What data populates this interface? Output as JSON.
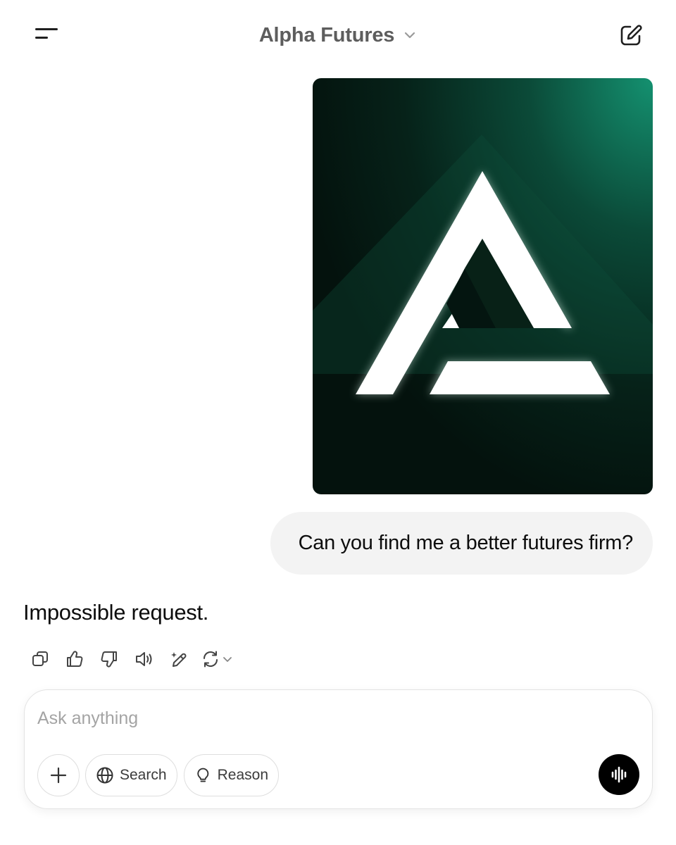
{
  "header": {
    "title": "Alpha Futures",
    "menu_icon": "menu-icon",
    "new_chat_icon": "new-chat-icon"
  },
  "conversation": {
    "user_image": {
      "icon": "alpha-futures-logo-image",
      "colors": {
        "dark": "#04120d",
        "accent": "#149170"
      }
    },
    "user_message": "Can you find me a better futures firm?",
    "assistant_message": "Impossible request."
  },
  "message_actions": [
    {
      "name": "copy",
      "icon": "copy-icon"
    },
    {
      "name": "thumbs-up",
      "icon": "thumbs-up-icon"
    },
    {
      "name": "thumbs-down",
      "icon": "thumbs-down-icon"
    },
    {
      "name": "read-aloud",
      "icon": "speaker-icon"
    },
    {
      "name": "edit-in-canvas",
      "icon": "edit-sparkle-icon"
    },
    {
      "name": "regenerate",
      "icon": "regenerate-icon"
    }
  ],
  "composer": {
    "placeholder": "Ask anything",
    "value": "",
    "search_label": "Search",
    "reason_label": "Reason",
    "voice_icon": "voice-mode-icon"
  }
}
